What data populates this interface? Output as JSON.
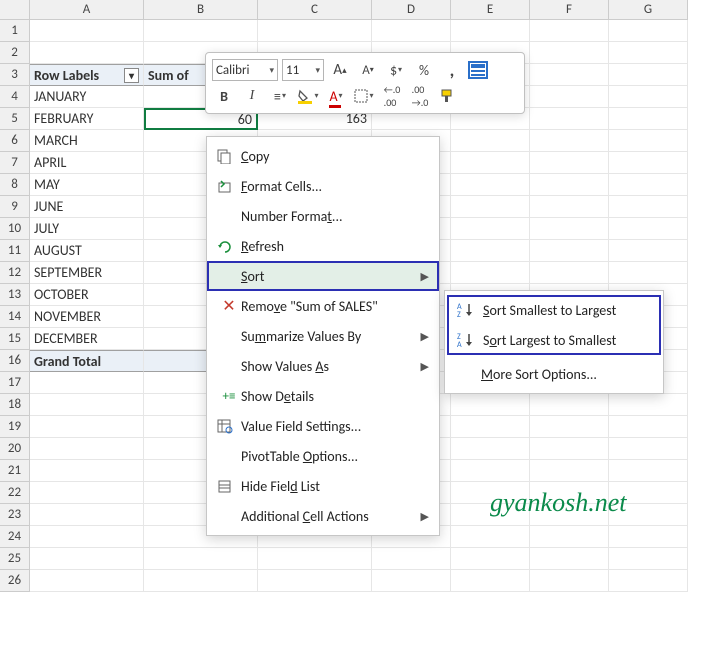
{
  "columns": [
    "A",
    "B",
    "C",
    "D",
    "E",
    "F",
    "G"
  ],
  "rows": [
    "1",
    "2",
    "3",
    "4",
    "5",
    "6",
    "7",
    "8",
    "9",
    "10",
    "11",
    "12",
    "13",
    "14",
    "15",
    "16",
    "17",
    "18",
    "19",
    "20",
    "21",
    "22",
    "23",
    "24",
    "25",
    "26"
  ],
  "pivot": {
    "header_a": "Row Labels",
    "header_b": "Sum of",
    "labels": [
      "JANUARY",
      "FEBRUARY",
      "MARCH",
      "APRIL",
      "MAY",
      "JUNE",
      "JULY",
      "AUGUST",
      "SEPTEMBER",
      "OCTOBER",
      "NOVEMBER",
      "DECEMBER"
    ],
    "grand_total": "Grand Total",
    "b5": "60",
    "c5": "163"
  },
  "mini": {
    "font_name": "Calibri",
    "font_size": "11"
  },
  "ctx": {
    "copy": "Copy",
    "format_cells": "Format Cells...",
    "number_format": "Number Format...",
    "refresh": "Refresh",
    "sort": "Sort",
    "remove": "Remove \"Sum of SALES\"",
    "summarize": "Summarize Values By",
    "show_as": "Show Values As",
    "show_details": "Show Details",
    "vfs": "Value Field Settings...",
    "pt_options": "PivotTable Options...",
    "hide_fl": "Hide Field List",
    "acca": "Additional Cell Actions"
  },
  "sub": {
    "asc": "Sort Smallest to Largest",
    "desc": "Sort Largest to Smallest",
    "more": "More Sort Options..."
  },
  "watermark": "gyankosh.net"
}
